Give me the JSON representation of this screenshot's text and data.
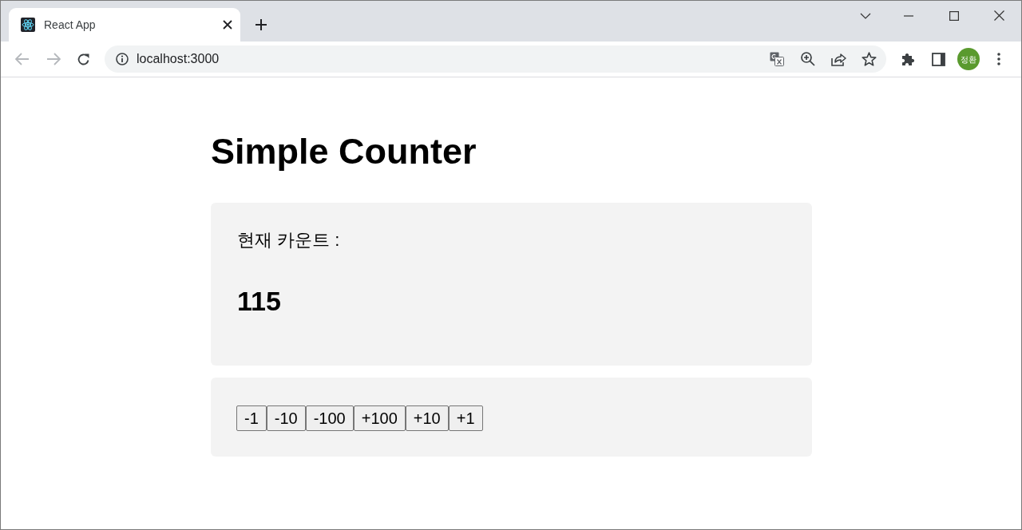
{
  "browser": {
    "tab_title": "React App",
    "address": "localhost:3000",
    "back_disabled": true,
    "forward_disabled": true,
    "profile": "정환"
  },
  "page": {
    "title": "Simple Counter",
    "count_label": "현재 카운트 :",
    "count": "115",
    "buttons": [
      "-1",
      "-10",
      "-100",
      "+100",
      "+10",
      "+1"
    ]
  }
}
